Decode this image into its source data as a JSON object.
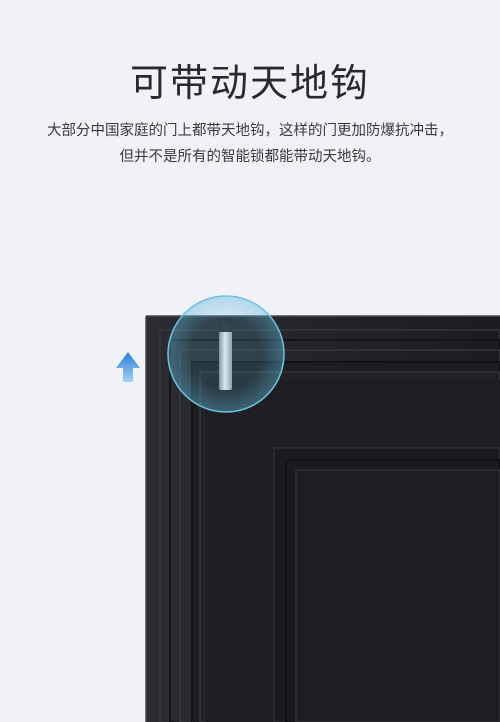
{
  "heading": "可带动天地钩",
  "description": {
    "line1": "大部分中国家庭的门上都带天地钩，这样的门更加防爆抗冲击，",
    "line2": "但并不是所有的智能锁都能带动天地钩。"
  },
  "colors": {
    "background": "#f1f2f8",
    "door": "#1f2024",
    "highlight_circle": "#5fb8d8",
    "arrow": "#2e7fd6"
  },
  "icons": {
    "arrow": "up-arrow-icon",
    "bolt": "latch-bolt"
  }
}
